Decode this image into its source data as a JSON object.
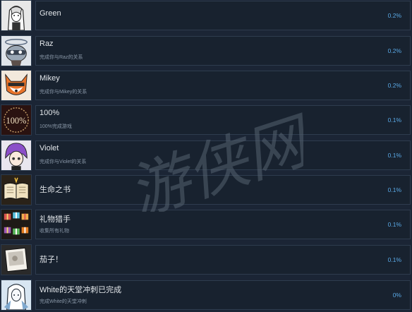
{
  "achievements": [
    {
      "title": "Green",
      "desc": "",
      "pct": "0.2%",
      "icon": "white-hair-portrait-icon"
    },
    {
      "title": "Raz",
      "desc": "完成你与Raz的关系",
      "pct": "0.2%",
      "icon": "raccoon-portrait-icon"
    },
    {
      "title": "Mikey",
      "desc": "完成你与Mikey的关系",
      "pct": "0.2%",
      "icon": "fox-portrait-icon"
    },
    {
      "title": "100%",
      "desc": "100%完成游戏",
      "pct": "0.1%",
      "icon": "hundred-percent-icon"
    },
    {
      "title": "Violet",
      "desc": "完成你与Violet的关系",
      "pct": "0.1%",
      "icon": "violet-portrait-icon"
    },
    {
      "title": "生命之书",
      "desc": "",
      "pct": "0.1%",
      "icon": "open-book-icon"
    },
    {
      "title": "礼物猎手",
      "desc": "收集所有礼物",
      "pct": "0.1%",
      "icon": "gift-boxes-icon"
    },
    {
      "title": "茄子！",
      "desc": "",
      "pct": "0.1%",
      "icon": "photo-card-icon"
    },
    {
      "title": "White的天堂冲刺已完成",
      "desc": "完成White的天堂冲刺",
      "pct": "0%",
      "icon": "white-portrait-icon"
    }
  ],
  "watermark": "游侠网",
  "colors": {
    "background": "#1b2535",
    "bar": "#18222f",
    "percent": "#5aa9e6",
    "title": "#e2e6ea",
    "desc": "#8a98a8"
  }
}
